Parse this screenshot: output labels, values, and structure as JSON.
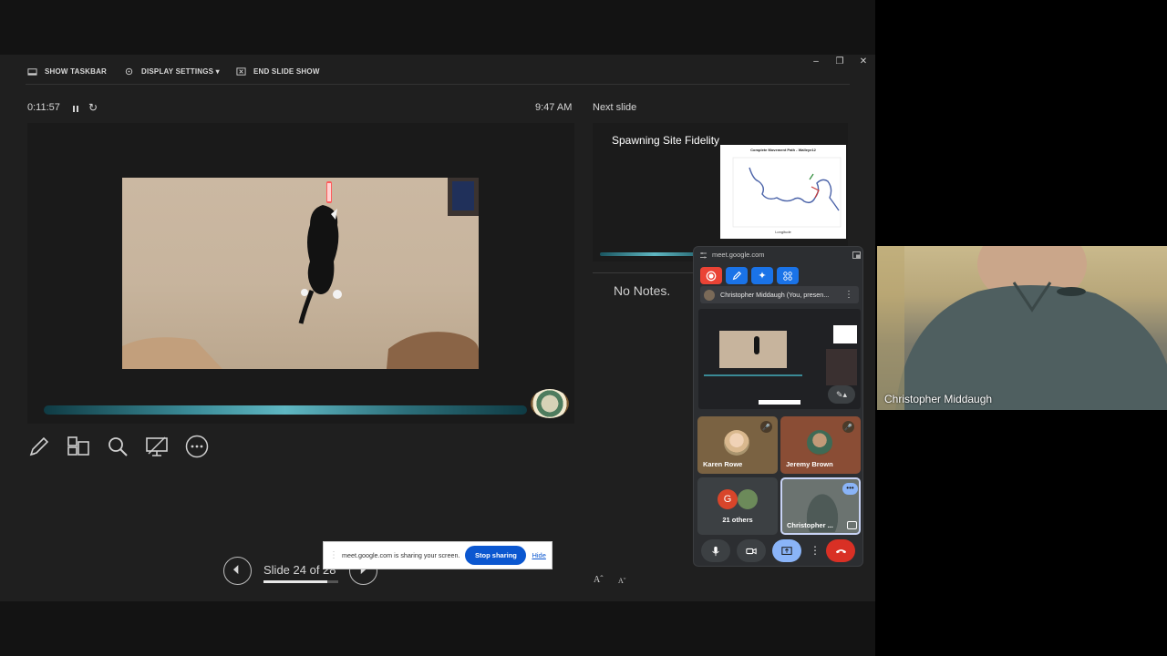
{
  "toolbar": {
    "show_taskbar": "SHOW TASKBAR",
    "display_settings": "DISPLAY SETTINGS ▾",
    "end_slide_show": "END SLIDE SHOW"
  },
  "status": {
    "elapsed": "0:11:57",
    "clock": "9:47 AM"
  },
  "next_slide": {
    "heading": "Next slide",
    "title": "Spawning Site Fidelity",
    "chart_title": "Complete Movement Path - Walleye12",
    "chart_xlabel": "Longitude"
  },
  "notes": {
    "text": "No Notes."
  },
  "navigation": {
    "slide_label": "Slide 24 of 28",
    "progress": 0.857
  },
  "share_bar": {
    "message": "meet.google.com is sharing your screen.",
    "stop_label": "Stop sharing",
    "hide_label": "Hide"
  },
  "meet": {
    "url": "meet.google.com",
    "presenting_label": "Christopher Middaugh (You, presen...",
    "participants": [
      {
        "name": "Karen Rowe",
        "muted": true
      },
      {
        "name": "Jeremy Brown",
        "muted": true
      },
      {
        "name": "21 others",
        "initial": "G"
      },
      {
        "name": "Christopher ..."
      }
    ]
  },
  "webcam": {
    "name": "Christopher Middaugh"
  },
  "colors": {
    "accent_blue": "#0b57d0",
    "record_red": "#ea4335",
    "hangup_red": "#d93025",
    "present_blue": "#8ab4f8"
  }
}
